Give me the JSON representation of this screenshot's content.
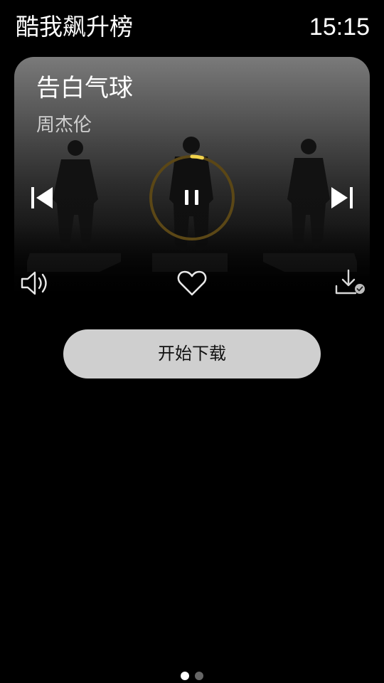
{
  "header": {
    "title": "酷我飙升榜",
    "time": "15:15"
  },
  "player": {
    "song_title": "告白气球",
    "artist": "周杰伦",
    "state": "playing",
    "progress": 0.04,
    "controls": {
      "previous": "previous-icon",
      "play_pause": "pause-icon",
      "next": "next-icon",
      "volume": "volume-icon",
      "like": "heart-icon",
      "download_status": "download-done-icon"
    },
    "colors": {
      "progress_track": "#5b4716",
      "progress_fill": "#f2d34c"
    }
  },
  "download_button": {
    "label": "开始下载"
  },
  "pager": {
    "count": 2,
    "active_index": 0
  }
}
